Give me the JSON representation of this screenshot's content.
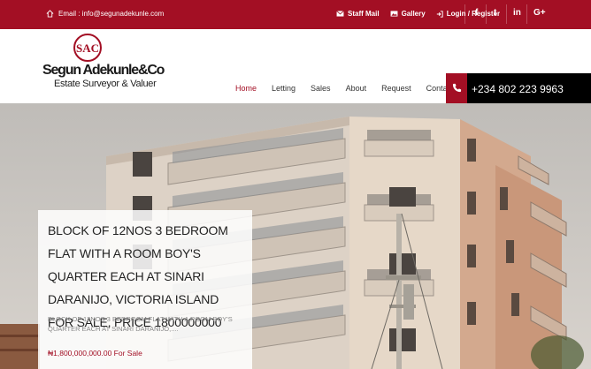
{
  "topbar": {
    "email": "Email : info@segunadekunle.com",
    "links": [
      {
        "label": "Staff Mail",
        "icon": "envelope-icon"
      },
      {
        "label": "Gallery",
        "icon": "gallery-icon"
      },
      {
        "label": "Login / Register",
        "icon": "login-icon"
      }
    ],
    "social": {
      "facebook": "f",
      "twitter": "t",
      "linkedin": "in",
      "google": "G+"
    }
  },
  "brand": {
    "monogram": "SAC",
    "name": "Segun Adekunle&Co",
    "tagline": "Estate Surveyor & Valuer"
  },
  "nav": {
    "items": [
      "Home",
      "Letting",
      "Sales",
      "About",
      "Request",
      "Contacts"
    ],
    "active": "Home"
  },
  "phone": "+234 802 223 9963",
  "hero": {
    "title": "BLOCK OF 12NOS 3 BEDROOM FLAT WITH A ROOM BOY'S QUARTER EACH AT SINARI DARANIJO, VICTORIA ISLAND FOR SALE, PRICE 1800000000",
    "description": "BLOCK OF 12NOS 3 BEDROOM FLAT WITH A ROOM BOY'S QUARTER EACH AT SINARI DARANIJO,....",
    "price": "₦1,800,000,000.00 For Sale"
  },
  "colors": {
    "brand_red": "#a30f24",
    "phone_bg": "#000000"
  }
}
